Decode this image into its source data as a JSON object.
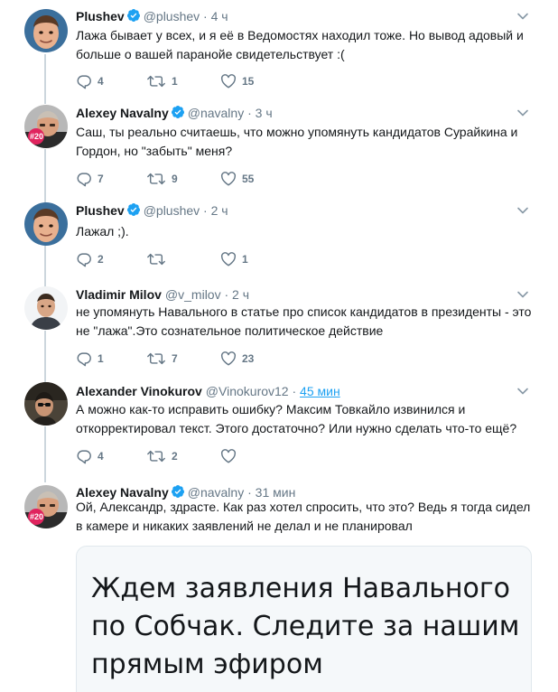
{
  "tweets": [
    {
      "name": "Plushev",
      "handle": "@plushev",
      "time": "4 ч",
      "text": "Лажа бывает у всех, и я её в Ведомостях находил тоже. Но вывод адовый и больше о вашей паранойе свидетельствует :(",
      "replies": "4",
      "retweets": "1",
      "likes": "15"
    },
    {
      "name": "Alexey Navalny",
      "handle": "@navalny",
      "time": "3 ч",
      "text": "Саш, ты реально считаешь, что можно упомянуть кандидатов Сурайкина и Гордон, но \"забыть\" меня?",
      "replies": "7",
      "retweets": "9",
      "likes": "55"
    },
    {
      "name": "Plushev",
      "handle": "@plushev",
      "time": "2 ч",
      "text": "Лажал ;).",
      "replies": "2",
      "retweets": "",
      "likes": "1"
    },
    {
      "name": "Vladimir Milov",
      "handle": "@v_milov",
      "time": "2 ч",
      "text": "не упомянуть Навального в статье про список кандидатов в президенты - это не \"лажа\".Это сознательное политическое действие",
      "replies": "1",
      "retweets": "7",
      "likes": "23"
    },
    {
      "name": "Alexander Vinokurov",
      "handle": "@Vinokurov12",
      "time": "45 мин",
      "text": "А можно как-то исправить ошибку? Максим Товкайло извинился и откорректировал текст. Этого достаточно? Или нужно сделать что-то ещё?",
      "replies": "4",
      "retweets": "2",
      "likes": ""
    },
    {
      "name": "Alexey Navalny",
      "handle": "@navalny",
      "time": "31 мин",
      "text": "Ой, Александр, здрасте. Как раз хотел спросить, что это? Ведь я тогда сидел в камере и никаких заявлений не делал и не планировал",
      "card_text": "Ждем заявления Навального по Собчак. Следите за нашим прямым эфиром"
    }
  ],
  "colors": {
    "verified": "#1da1f2",
    "thread_line": "#ccd6dd",
    "meta": "#657786",
    "link": "#1da1f2",
    "avatar_badge": "#e0245e"
  },
  "avatars": {
    "navalny_badge": "#20"
  }
}
